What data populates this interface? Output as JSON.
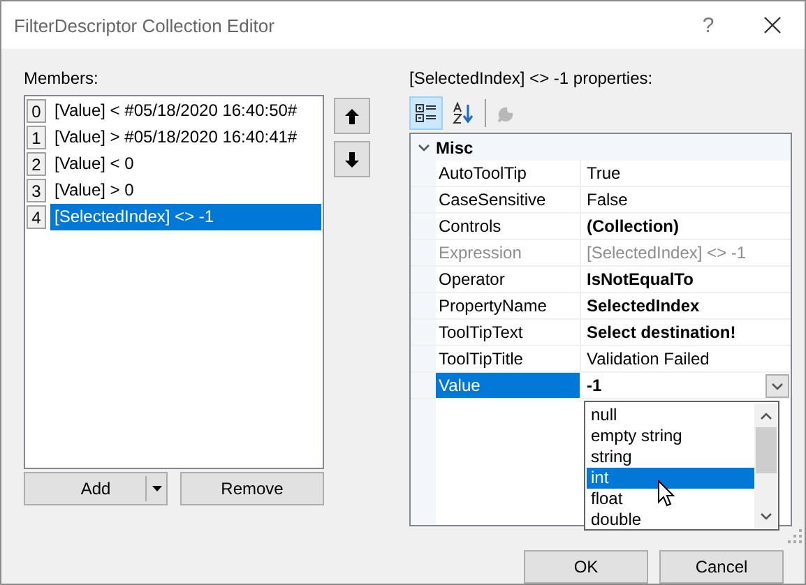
{
  "window": {
    "title": "FilterDescriptor Collection Editor",
    "help": "?"
  },
  "members": {
    "label": "Members:",
    "items": [
      {
        "index": "0",
        "text": "[Value] < #05/18/2020 16:40:50#",
        "selected": false
      },
      {
        "index": "1",
        "text": "[Value] > #05/18/2020 16:40:41#",
        "selected": false
      },
      {
        "index": "2",
        "text": "[Value] < 0",
        "selected": false
      },
      {
        "index": "3",
        "text": "[Value] > 0",
        "selected": false
      },
      {
        "index": "4",
        "text": "[SelectedIndex] <> -1",
        "selected": true
      }
    ]
  },
  "add_button": "Add",
  "remove_button": "Remove",
  "properties": {
    "label": "[SelectedIndex] <> -1 properties:",
    "toolbar": [
      {
        "kind": "categorized",
        "selected": true,
        "disabled": false
      },
      {
        "kind": "alphabetical",
        "selected": false,
        "disabled": false
      },
      {
        "kind": "pages",
        "selected": false,
        "disabled": true
      }
    ],
    "categories": [
      {
        "name": "Misc",
        "expanded": true,
        "rows": [
          {
            "name": "AutoToolTip",
            "value": "True",
            "bold": false,
            "disabled": false,
            "selected": false,
            "dropdown_button": false
          },
          {
            "name": "CaseSensitive",
            "value": "False",
            "bold": false,
            "disabled": false,
            "selected": false,
            "dropdown_button": false
          },
          {
            "name": "Controls",
            "value": "(Collection)",
            "bold": true,
            "disabled": false,
            "selected": false,
            "dropdown_button": false
          },
          {
            "name": "Expression",
            "value": "[SelectedIndex] <> -1",
            "bold": false,
            "disabled": true,
            "selected": false,
            "dropdown_button": false
          },
          {
            "name": "Operator",
            "value": "IsNotEqualTo",
            "bold": true,
            "disabled": false,
            "selected": false,
            "dropdown_button": false
          },
          {
            "name": "PropertyName",
            "value": "SelectedIndex",
            "bold": true,
            "disabled": false,
            "selected": false,
            "dropdown_button": false
          },
          {
            "name": "ToolTipText",
            "value": "Select destination!",
            "bold": true,
            "disabled": false,
            "selected": false,
            "dropdown_button": false
          },
          {
            "name": "ToolTipTitle",
            "value": "Validation Failed",
            "bold": false,
            "disabled": false,
            "selected": false,
            "dropdown_button": false
          },
          {
            "name": "Value",
            "value": "-1",
            "bold": true,
            "disabled": false,
            "selected": true,
            "dropdown_button": true
          }
        ]
      }
    ]
  },
  "dropdown": {
    "items": [
      {
        "text": "null",
        "selected": false
      },
      {
        "text": "empty string",
        "selected": false
      },
      {
        "text": "string",
        "selected": false
      },
      {
        "text": "int",
        "selected": true
      },
      {
        "text": "float",
        "selected": false
      },
      {
        "text": "double",
        "selected": false
      }
    ]
  },
  "ok_button": "OK",
  "cancel_button": "Cancel"
}
